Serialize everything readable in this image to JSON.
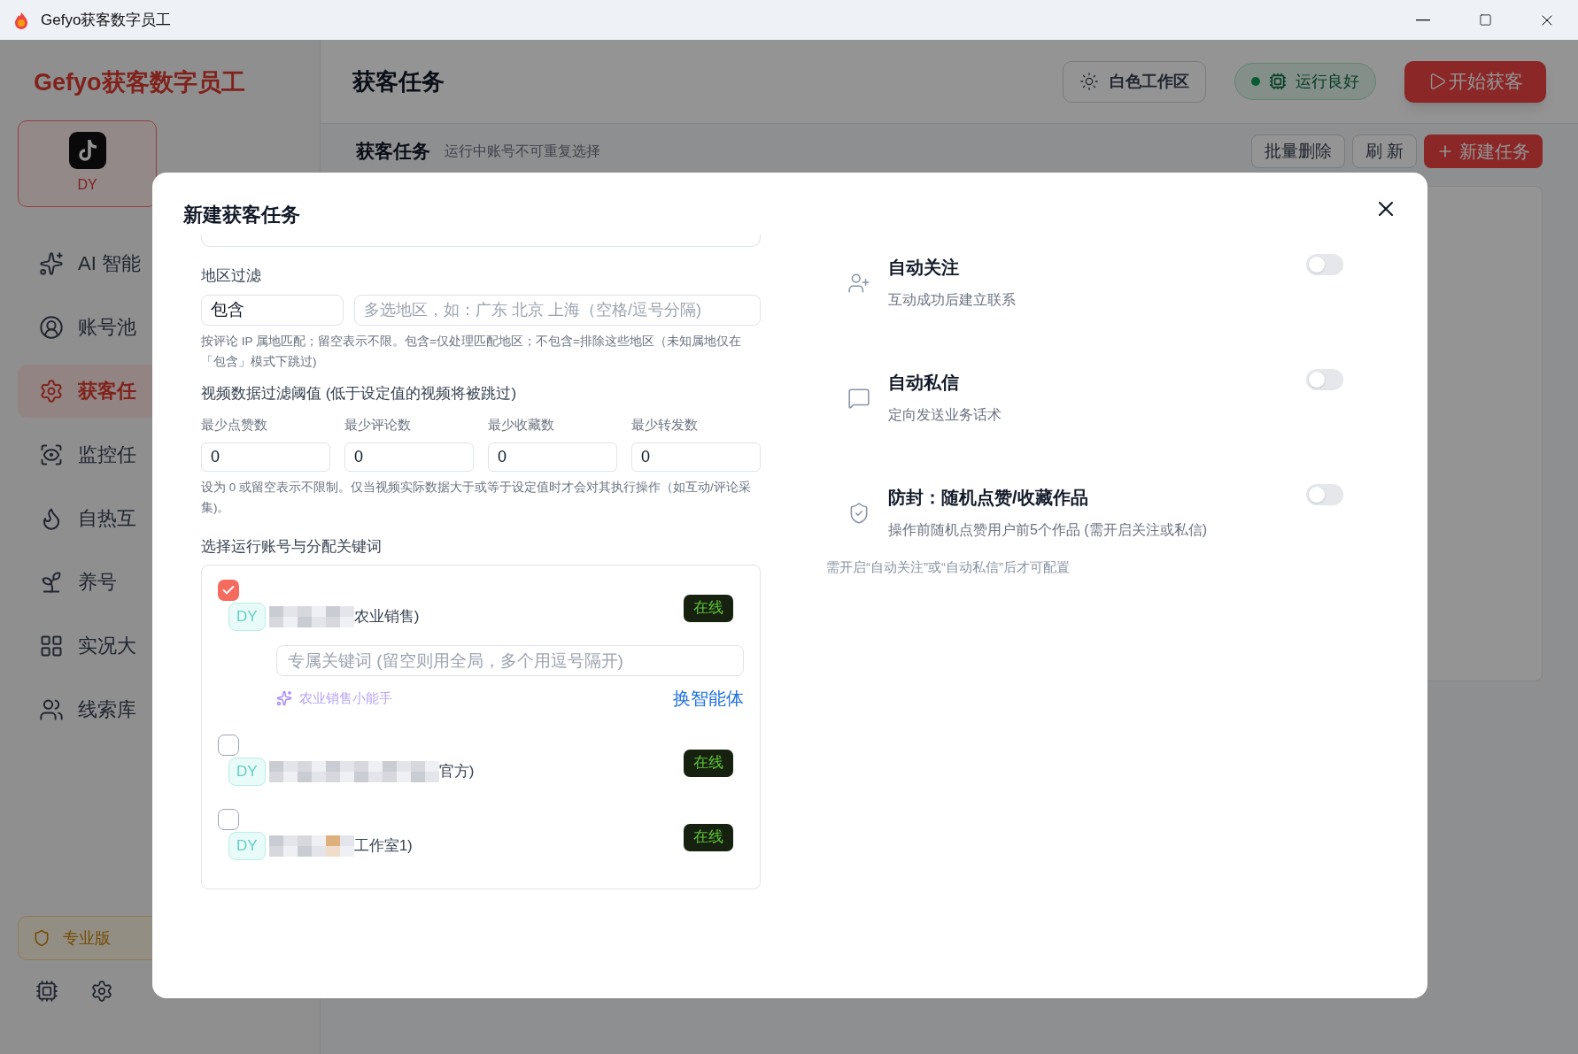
{
  "window": {
    "title": "Gefyo获客数字员工"
  },
  "sidebar": {
    "brand": "Gefyo获客数字员工",
    "platform": {
      "label": "DY",
      "selected": true
    },
    "items": [
      {
        "label": "AI 智能",
        "selected": false
      },
      {
        "label": "账号池",
        "selected": false
      },
      {
        "label": "获客任",
        "selected": true
      },
      {
        "label": "监控任",
        "selected": false
      },
      {
        "label": "自热互",
        "selected": false
      },
      {
        "label": "养号",
        "selected": false
      },
      {
        "label": "实况大",
        "selected": false
      },
      {
        "label": "线索库",
        "selected": false
      }
    ],
    "plan_badge": "专业版"
  },
  "header": {
    "title": "获客任务",
    "theme_button": "白色工作区",
    "status": "运行良好",
    "start_button": "开始获客"
  },
  "section": {
    "title": "获客任务",
    "subtitle": "运行中账号不可重复选择",
    "buttons": [
      {
        "label": "批量删除",
        "kind": "plain"
      },
      {
        "label": "刷 新",
        "kind": "plain"
      },
      {
        "label": "新建任务",
        "kind": "primary"
      }
    ]
  },
  "dialog": {
    "title": "新建获客任务",
    "region_filter": {
      "label": "地区过滤",
      "mode": "包含",
      "placeholder": "多选地区，如：广东 北京 上海（空格/逗号分隔)",
      "hint": "按评论 IP 属地匹配；留空表示不限。包含=仅处理匹配地区；不包含=排除这些地区（未知属地仅在「包含」模式下跳过)"
    },
    "thresholds": {
      "label": "视频数据过滤阈值 (低于设定值的视频将被跳过)",
      "fields": [
        {
          "label": "最少点赞数",
          "value": "0"
        },
        {
          "label": "最少评论数",
          "value": "0"
        },
        {
          "label": "最少收藏数",
          "value": "0"
        },
        {
          "label": "最少转发数",
          "value": "0"
        }
      ],
      "hint": "设为 0 或留空表示不限制。仅当视频实际数据大于或等于设定值时才会对其执行操作（如互动/评论采集)。"
    },
    "accounts": {
      "label": "选择运行账号与分配关键词",
      "items": [
        {
          "checked": true,
          "platform": "DY",
          "name": "农业销售)",
          "status": "在线",
          "keyword_placeholder": "专属关键词 (留空则用全局，多个用逗号隔开)",
          "agent": "农业销售小能手",
          "switch_agent": "换智能体"
        },
        {
          "checked": false,
          "platform": "DY",
          "name": "官方)",
          "status": "在线"
        },
        {
          "checked": false,
          "platform": "DY",
          "name": "工作室1)",
          "status": "在线"
        }
      ]
    },
    "options": [
      {
        "title": "自动关注",
        "description": "互动成功后建立联系",
        "on": false
      },
      {
        "title": "自动私信",
        "description": "定向发送业务话术",
        "on": false
      },
      {
        "title": "防封：随机点赞/收藏作品",
        "description": "操作前随机点赞用户前5个作品 (需开启关注或私信)",
        "on": false
      }
    ],
    "note": "需开启“自动关注”或“自动私信”后才可配置"
  }
}
